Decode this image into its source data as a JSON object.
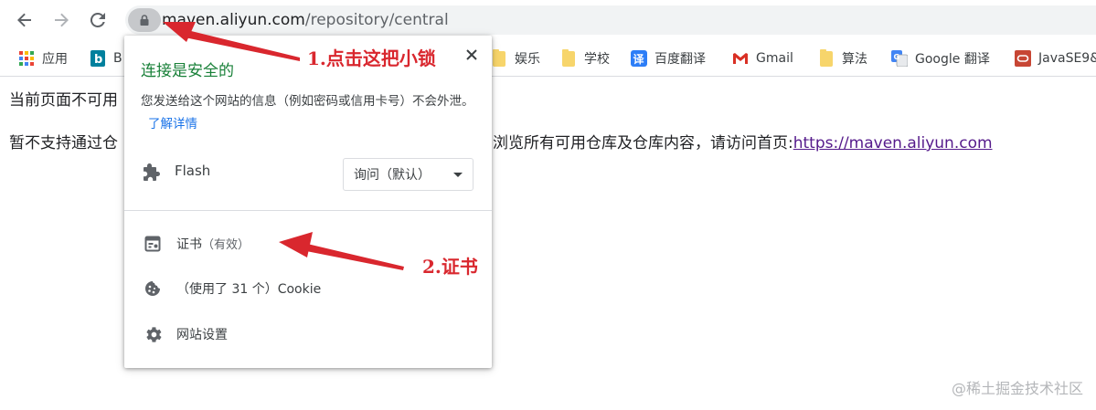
{
  "toolbar": {
    "url_host": "maven.aliyun.com",
    "url_path": "/repository/central"
  },
  "bookmarks": [
    {
      "label": "应用",
      "icon": "apps-grid-icon"
    },
    {
      "label": "B",
      "icon": "bing-icon"
    },
    {
      "label": "娱乐",
      "icon": "folder-icon"
    },
    {
      "label": "学校",
      "icon": "folder-icon"
    },
    {
      "label": "百度翻译",
      "icon": "translate-icon"
    },
    {
      "label": "Gmail",
      "icon": "gmail-icon"
    },
    {
      "label": "算法",
      "icon": "folder-icon"
    },
    {
      "label": "Google 翻译",
      "icon": "google-translate-icon"
    },
    {
      "label": "JavaSE9&",
      "icon": "oracle-icon"
    }
  ],
  "page": {
    "line1": "当前页面不可用",
    "line2_left": "暂不支持通过仓",
    "line2_right": "浏览所有可用仓库及仓库内容，请访问首页:",
    "link": "https://maven.aliyun.com"
  },
  "popup": {
    "title": "连接是安全的",
    "description": "您发送给这个网站的信息（例如密码或信用卡号）不会外泄。",
    "learn_more": "了解详情",
    "flash_label": "Flash",
    "flash_select": "询问（默认）",
    "certificate_label": "证书",
    "certificate_status": "（有效）",
    "cookie_label": "（使用了 31 个）Cookie",
    "site_settings": "网站设置"
  },
  "annotations": {
    "step1": "1.点击这把小锁",
    "step2": "2.证书",
    "color": "#d9272e"
  },
  "watermark": "@稀土掘金技术社区",
  "colors": {
    "secure_green": "#188038",
    "link_blue": "#1a73e8",
    "visited_link": "#551a8b"
  }
}
